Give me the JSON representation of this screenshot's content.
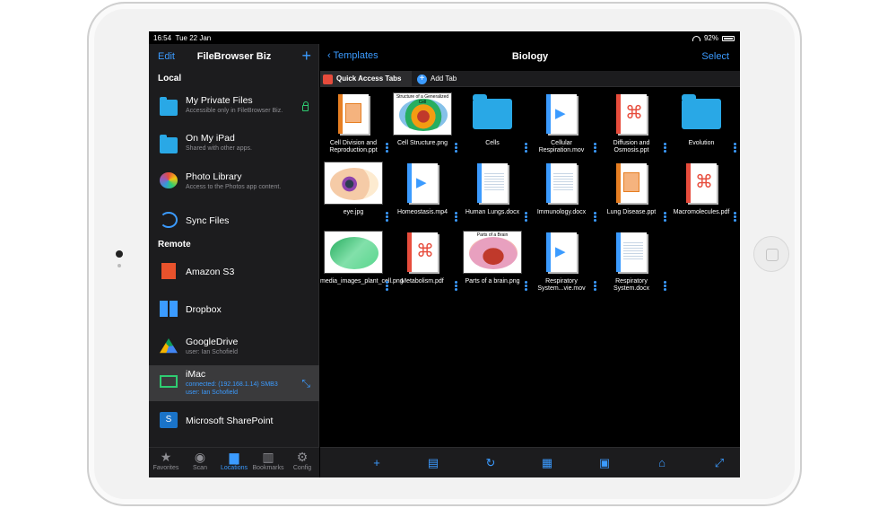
{
  "status": {
    "time": "16:54",
    "date": "Tue 22 Jan",
    "battery": "92%"
  },
  "sidebar": {
    "edit": "Edit",
    "title": "FileBrowser Biz",
    "add": "+",
    "local_header": "Local",
    "remote_header": "Remote",
    "local": [
      {
        "label": "My Private Files",
        "sub": "Accessible only in FileBrowser Biz."
      },
      {
        "label": "On My iPad",
        "sub": "Shared with other apps."
      },
      {
        "label": "Photo Library",
        "sub": "Access to the Photos app content."
      },
      {
        "label": "Sync Files",
        "sub": ""
      }
    ],
    "remote": [
      {
        "label": "Amazon S3",
        "sub": ""
      },
      {
        "label": "Dropbox",
        "sub": ""
      },
      {
        "label": "GoogleDrive",
        "sub": "user: Ian Schofield"
      },
      {
        "label": "iMac",
        "sub": "connected: (192.168.1.14) SMB3",
        "sub2": "user: Ian Schofield"
      },
      {
        "label": "Microsoft SharePoint",
        "sub": ""
      }
    ],
    "tabs": [
      "Favorites",
      "Scan",
      "Locations",
      "Bookmarks",
      "Config"
    ]
  },
  "main": {
    "back": "Templates",
    "title": "Biology",
    "select": "Select",
    "quick_access": "Quick Access Tabs",
    "add_tab": "Add Tab",
    "files": [
      {
        "name": "Cell Division and Reproduction.ppt",
        "type": "ppt"
      },
      {
        "name": "Cell Structure.png",
        "type": "img",
        "thumb_label": "Structure of a Generalized Cell"
      },
      {
        "name": "Cells",
        "type": "folder"
      },
      {
        "name": "Cellular Respiration.mov",
        "type": "mov"
      },
      {
        "name": "Diffusion and Osmosis.ppt",
        "type": "pdf"
      },
      {
        "name": "Evolution",
        "type": "folder"
      },
      {
        "name": "eye.jpg",
        "type": "img"
      },
      {
        "name": "Homeostasis.mp4",
        "type": "mp4"
      },
      {
        "name": "Human Lungs.docx",
        "type": "docx"
      },
      {
        "name": "Immunology.docx",
        "type": "docx"
      },
      {
        "name": "Lung Disease.ppt",
        "type": "ppt"
      },
      {
        "name": "Macromolecules.pdf",
        "type": "pdf"
      },
      {
        "name": "media_images_plant_cell.png",
        "type": "img"
      },
      {
        "name": "Metabolism.pdf",
        "type": "pdf"
      },
      {
        "name": "Parts of a brain.png",
        "type": "img",
        "thumb_label": "Parts of a Brain"
      },
      {
        "name": "Respiratory System...vie.mov",
        "type": "mov"
      },
      {
        "name": "Respiratory System.docx",
        "type": "docx"
      }
    ]
  },
  "colors": {
    "accent": "#3b9bff",
    "background": "#000000",
    "panel": "#1c1c1e",
    "folder": "#29a8e6"
  }
}
